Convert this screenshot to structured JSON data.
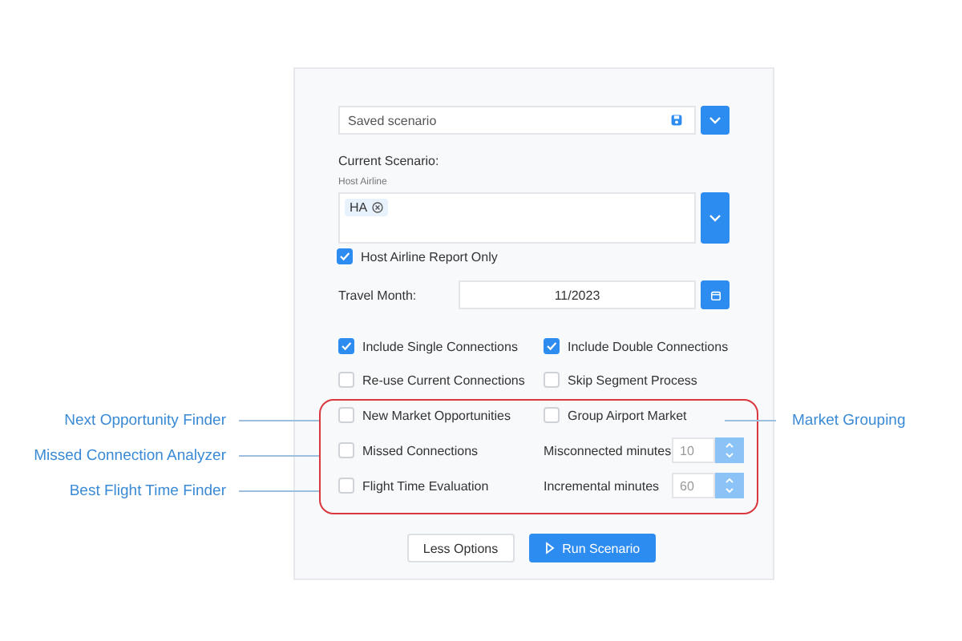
{
  "saved_scenario": {
    "placeholder": "Saved scenario"
  },
  "current_scenario": {
    "heading": "Current Scenario:",
    "host_airline": {
      "label": "Host Airline",
      "chips": [
        "HA"
      ]
    }
  },
  "host_airline_report_only": {
    "label": "Host Airline Report Only",
    "checked": true
  },
  "travel_month": {
    "label": "Travel Month:",
    "value": "11/2023"
  },
  "options": [
    {
      "label": "Include Single Connections",
      "checked": true
    },
    {
      "label": "Include Double Connections",
      "checked": true
    },
    {
      "label": "Re-use Current Connections",
      "checked": false
    },
    {
      "label": "Skip Segment Process",
      "checked": false
    }
  ],
  "highlighted": {
    "rows": [
      {
        "option": {
          "label": "New Market Opportunities",
          "checked": false
        },
        "right": {
          "kind": "checkbox",
          "label": "Group Airport Market",
          "checked": false
        }
      },
      {
        "option": {
          "label": "Missed Connections",
          "checked": false
        },
        "right": {
          "kind": "number",
          "label": "Misconnected minutes",
          "placeholder": "10"
        }
      },
      {
        "option": {
          "label": "Flight Time Evaluation",
          "checked": false
        },
        "right": {
          "kind": "number",
          "label": "Incremental minutes",
          "placeholder": "60"
        }
      }
    ]
  },
  "annotations_left": [
    "Next Opportunity Finder",
    "Missed Connection Analyzer",
    "Best Flight Time Finder"
  ],
  "annotation_right": "Market Grouping",
  "buttons": {
    "secondary": "Less Options",
    "primary": "Run Scenario"
  }
}
